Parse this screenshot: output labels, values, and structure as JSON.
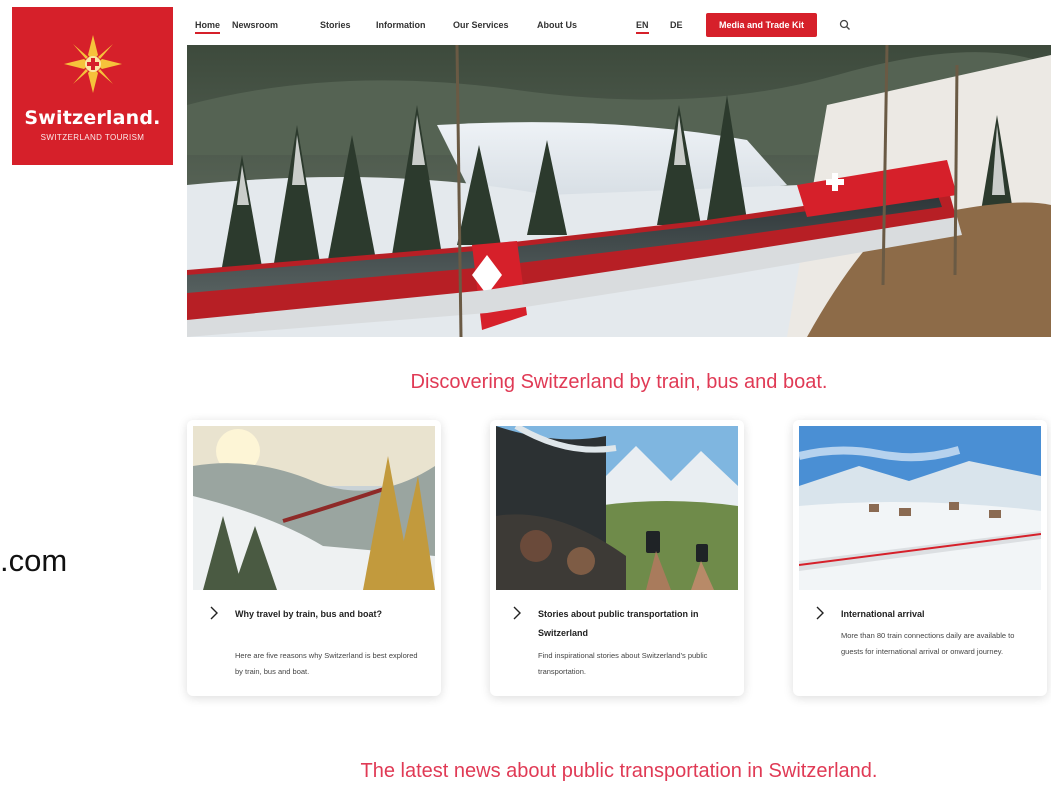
{
  "logo": {
    "word": "Switzerland.",
    "tagline": "SWITZERLAND TOURISM"
  },
  "side_text": ".com",
  "nav": {
    "items": [
      "Home",
      "Newsroom",
      "Stories",
      "Information",
      "Our Services",
      "About Us"
    ],
    "languages": [
      "EN",
      "DE"
    ],
    "kit_button": "Media and Trade Kit"
  },
  "heading_1": "Discovering Switzerland by train, bus and boat.",
  "cards": [
    {
      "title": "Why travel by train, bus and boat?",
      "description": "Here are five reasons why Switzerland is best explored by train, bus and boat."
    },
    {
      "title": "Stories about public transportation in Switzerland",
      "description": "Find inspirational stories about Switzerland's public transportation."
    },
    {
      "title": "International arrival",
      "description": "More than 80 train connections daily are available to guests for international arrival or onward journey."
    }
  ],
  "heading_2": "The latest news about public transportation in Switzerland.",
  "colors": {
    "brand_red": "#d6202a",
    "heading_pink": "#e03a55"
  }
}
